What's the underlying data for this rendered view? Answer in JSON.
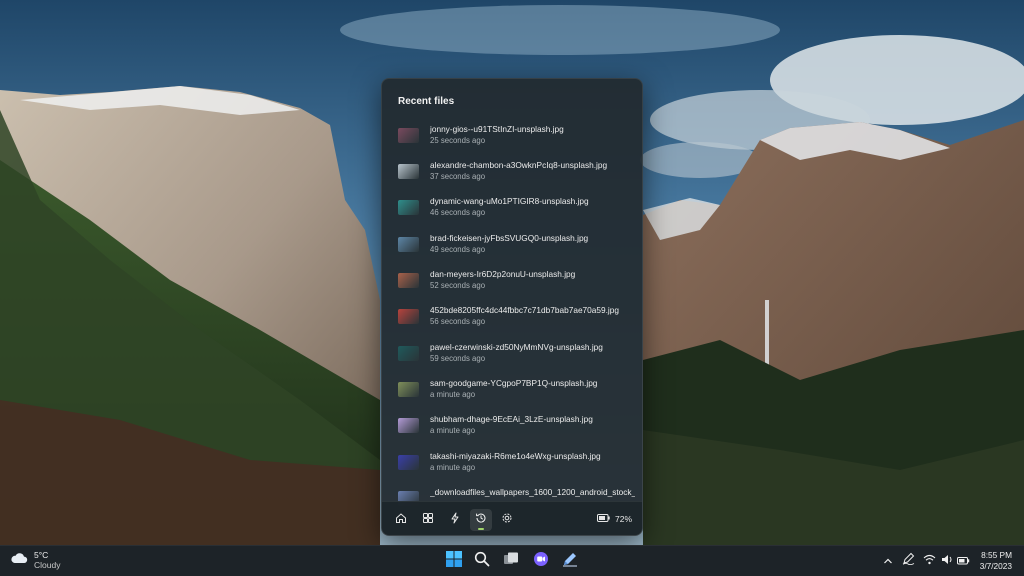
{
  "wallpaper": {
    "description_icon": "landscape-wallpaper"
  },
  "flyout": {
    "title": "Recent files",
    "files": [
      {
        "name": "jonny-gios--u91TStInZI-unsplash.jpg",
        "time": "25 seconds ago",
        "thumb_color": "#7a4a5e"
      },
      {
        "name": "alexandre-chambon-a3OwknPcIq8-unsplash.jpg",
        "time": "37 seconds ago",
        "thumb_color": "#b8c4cc"
      },
      {
        "name": "dynamic-wang-uMo1PTIGIR8-unsplash.jpg",
        "time": "46 seconds ago",
        "thumb_color": "#2f8f8c"
      },
      {
        "name": "brad-fickeisen-jyFbsSVUGQ0-unsplash.jpg",
        "time": "49 seconds ago",
        "thumb_color": "#5d86a6"
      },
      {
        "name": "dan-meyers-Ir6D2p2onuU-unsplash.jpg",
        "time": "52 seconds ago",
        "thumb_color": "#a8614a"
      },
      {
        "name": "452bde8205ffc4dc44fbbc7c71db7bab7ae70a59.jpg",
        "time": "56 seconds ago",
        "thumb_color": "#b8433d"
      },
      {
        "name": "pawel-czerwinski-zd50NyMmNVg-unsplash.jpg",
        "time": "59 seconds ago",
        "thumb_color": "#1f5a5c"
      },
      {
        "name": "sam-goodgame-YCgpoP7BP1Q-unsplash.jpg",
        "time": "a minute ago",
        "thumb_color": "#7f8f5a"
      },
      {
        "name": "shubham-dhage-9EcEAi_3LzE-unsplash.jpg",
        "time": "a minute ago",
        "thumb_color": "#b39bd6"
      },
      {
        "name": "takashi-miyazaki-R6me1o4eWxg-unsplash.jpg",
        "time": "a minute ago",
        "thumb_color": "#3a3fa8"
      },
      {
        "name": "_downloadfiles_wallpapers_1600_1200_android_stock_...",
        "time": "",
        "thumb_color": "#6a7fb0"
      }
    ],
    "nav": [
      {
        "icon": "home-icon"
      },
      {
        "icon": "apps-icon"
      },
      {
        "icon": "lightning-icon"
      },
      {
        "icon": "history-icon",
        "active": true
      },
      {
        "icon": "gear-icon"
      }
    ],
    "battery": {
      "icon": "battery-icon",
      "percent": "72%"
    },
    "accent_color": "#9fd36a"
  },
  "taskbar": {
    "weather": {
      "icon": "cloud-icon",
      "temp": "5°C",
      "condition": "Cloudy"
    },
    "apps": [
      {
        "icon": "windows-start-icon"
      },
      {
        "icon": "search-icon"
      },
      {
        "icon": "task-view-icon"
      },
      {
        "icon": "chat-app-icon"
      },
      {
        "icon": "pen-app-icon"
      }
    ],
    "tray": [
      {
        "icon": "chevron-up-icon"
      },
      {
        "icon": "pen-menu-icon"
      },
      {
        "icon": "wifi-icon"
      },
      {
        "icon": "speaker-icon"
      },
      {
        "icon": "battery-plug-icon"
      }
    ],
    "clock": {
      "time": "8:55 PM",
      "date": "3/7/2023"
    }
  }
}
